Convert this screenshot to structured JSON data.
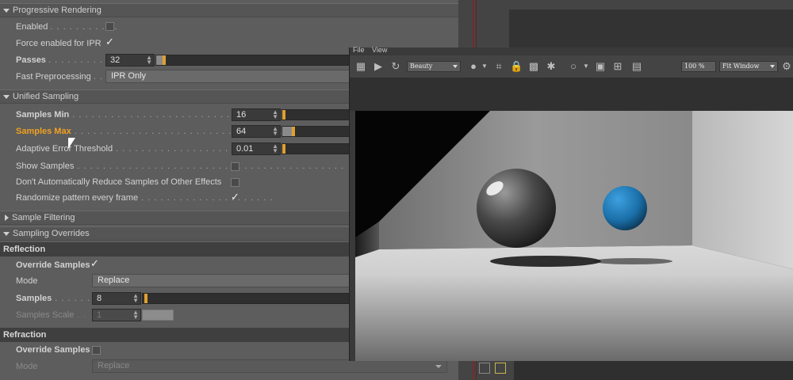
{
  "progressive": {
    "title": "Progressive Rendering",
    "enabled_label": "Enabled",
    "force_ipr_label": "Force enabled for IPR",
    "passes_label": "Passes",
    "passes_value": "32",
    "fast_preprocessing_label": "Fast Preprocessing",
    "fast_preprocessing_value": "IPR Only"
  },
  "unified": {
    "title": "Unified Sampling",
    "samples_min_label": "Samples Min",
    "samples_min_value": "16",
    "samples_max_label": "Samples Max",
    "samples_max_value": "64",
    "adaptive_error_label": "Adaptive Error Threshold",
    "adaptive_error_value": "0.01",
    "show_samples_label": "Show Samples",
    "dont_reduce_label": "Don't Automatically Reduce Samples of Other Effects",
    "randomize_label": "Randomize pattern every frame"
  },
  "sample_filtering": {
    "title": "Sample Filtering"
  },
  "sampling_overrides": {
    "title": "Sampling Overrides"
  },
  "reflection": {
    "title": "Reflection",
    "override_label": "Override Samples",
    "mode_label": "Mode",
    "mode_value": "Replace",
    "samples_label": "Samples",
    "samples_value": "8",
    "scale_label": "Samples Scale",
    "scale_value": "1"
  },
  "refraction": {
    "title": "Refraction",
    "override_label": "Override Samples",
    "mode_label": "Mode",
    "mode_value": "Replace"
  },
  "render_view": {
    "menu_file": "File",
    "menu_view": "View",
    "aov_value": "Beauty",
    "zoom_value": "100 %",
    "fit_value": "Fit Window"
  },
  "colors": {
    "accent": "#f0a020",
    "sphere_blue": "#1f7fc0"
  }
}
